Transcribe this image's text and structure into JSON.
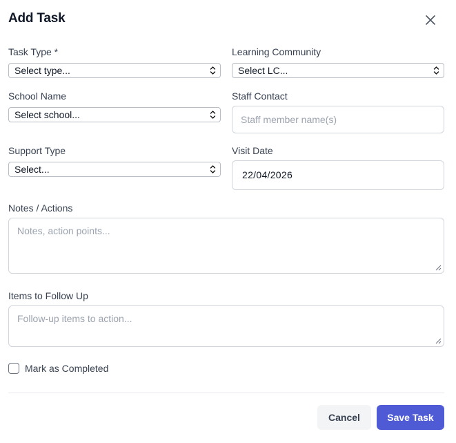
{
  "dialog": {
    "title": "Add Task",
    "close_icon": "close-icon"
  },
  "fields": {
    "task_type": {
      "label": "Task Type *",
      "value": "Select type..."
    },
    "learning_community": {
      "label": "Learning Community",
      "value": "Select LC..."
    },
    "school_name": {
      "label": "School Name",
      "value": "Select school..."
    },
    "staff_contact": {
      "label": "Staff Contact",
      "placeholder": "Staff member name(s)",
      "value": ""
    },
    "support_type": {
      "label": "Support Type",
      "value": "Select..."
    },
    "visit_date": {
      "label": "Visit Date",
      "value": "22/04/2026"
    },
    "notes": {
      "label": "Notes / Actions",
      "placeholder": "Notes, action points..."
    },
    "follow_up": {
      "label": "Items to Follow Up",
      "placeholder": "Follow-up items to action..."
    }
  },
  "completed": {
    "label": "Mark as Completed",
    "checked": false
  },
  "actions": {
    "cancel_label": "Cancel",
    "save_label": "Save Task"
  },
  "colors": {
    "primary": "#4f5bd5",
    "cancel_bg": "#f3f4f6"
  }
}
